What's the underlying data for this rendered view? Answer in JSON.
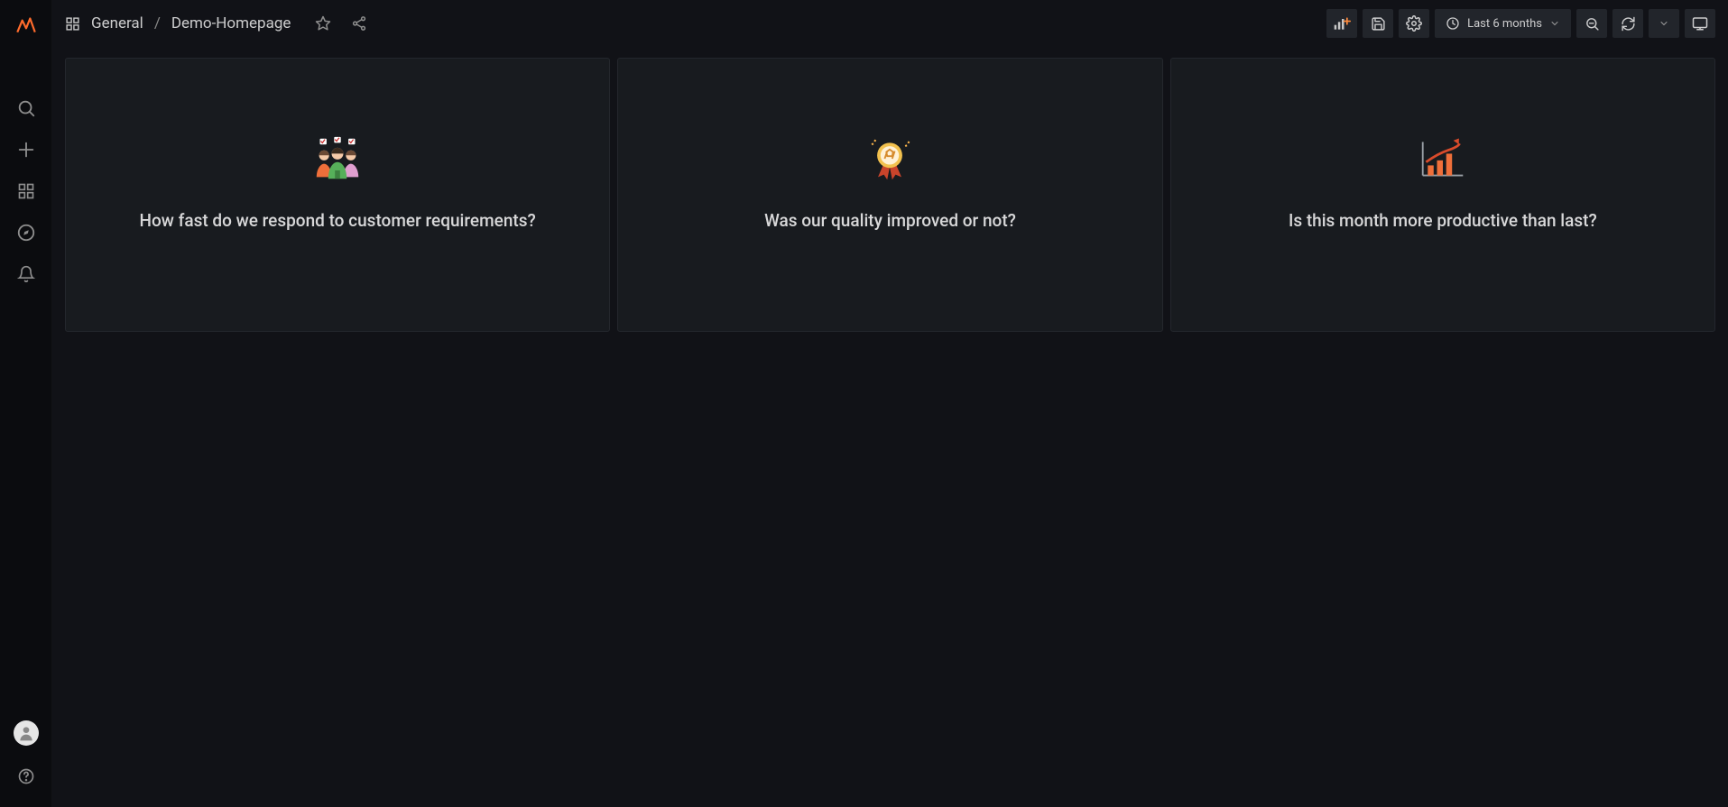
{
  "breadcrumb": {
    "folder": "General",
    "title": "Demo-Homepage"
  },
  "toolbar": {
    "time_range": "Last 6 months"
  },
  "panels": [
    {
      "icon": "team",
      "title": "How fast do we respond to customer requirements?"
    },
    {
      "icon": "badge",
      "title": "Was our quality improved or not?"
    },
    {
      "icon": "growth",
      "title": "Is this month more productive than last?"
    }
  ]
}
